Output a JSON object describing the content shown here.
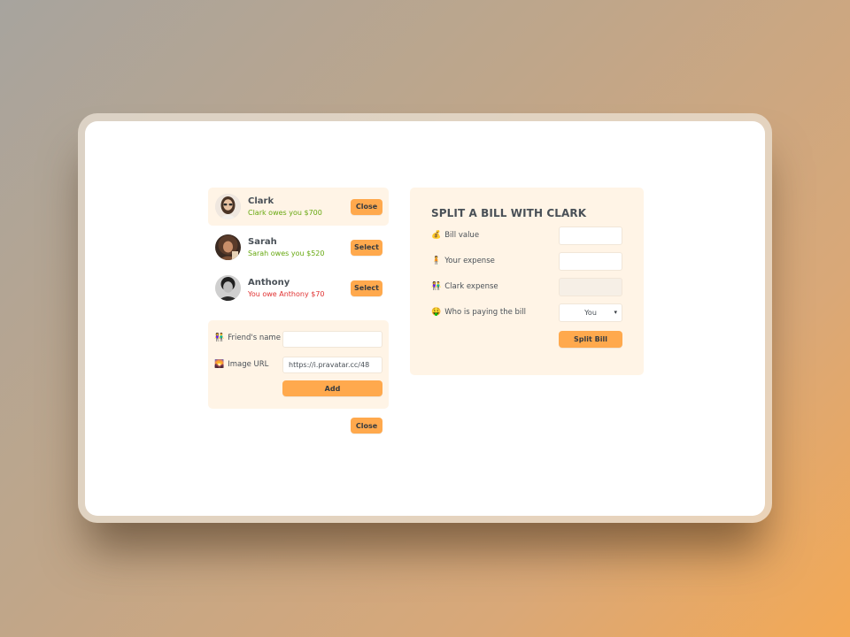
{
  "friends": [
    {
      "name": "Clark",
      "balance_text": "Clark owes you $700",
      "balance_color": "#66a80f",
      "button_label": "Close",
      "selected": true,
      "avatar_icon": "avatar-woman-glasses"
    },
    {
      "name": "Sarah",
      "balance_text": "Sarah owes you $520",
      "balance_color": "#66a80f",
      "button_label": "Select",
      "selected": false,
      "avatar_icon": "avatar-woman-curly"
    },
    {
      "name": "Anthony",
      "balance_text": "You owe Anthony $70",
      "balance_color": "#e03131",
      "button_label": "Select",
      "selected": false,
      "avatar_icon": "avatar-man-bw"
    }
  ],
  "add_friend": {
    "name_label": "Friend's name",
    "name_emoji": "👫",
    "name_value": "",
    "image_label": "Image URL",
    "image_emoji": "🌄",
    "image_value": "https://i.pravatar.cc/48",
    "add_label": "Add",
    "close_label": "Close"
  },
  "split": {
    "title": "SPLIT A BILL WITH CLARK",
    "bill_label": "Bill value",
    "bill_emoji": "💰",
    "bill_value": "",
    "your_expense_label": "Your expense",
    "your_expense_emoji": "🧍",
    "your_expense_value": "",
    "friend_expense_label": "Clark expense",
    "friend_expense_emoji": "👫",
    "friend_expense_value": "",
    "payer_label": "Who is paying the bill",
    "payer_emoji": "🤑",
    "payer_selected": "You",
    "submit_label": "Split Bill"
  },
  "colors": {
    "accent": "#ffa94d",
    "panel": "#fff4e6",
    "positive": "#66a80f",
    "negative": "#e03131"
  }
}
